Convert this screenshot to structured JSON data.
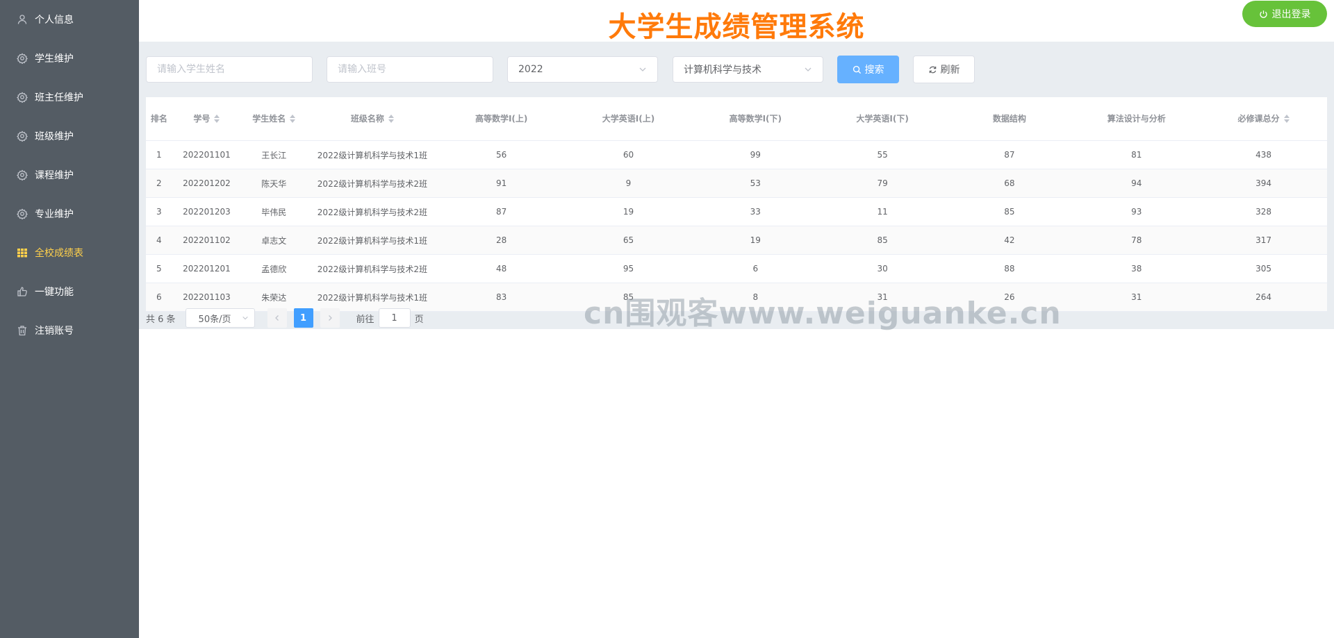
{
  "app": {
    "title": "大学生成绩管理系统",
    "logout_label": "退出登录",
    "accent_color": "#ff7a0a",
    "sidebar_bg": "#545c64",
    "active_menu_color": "#ffd04b"
  },
  "sidebar": {
    "items": [
      {
        "label": "个人信息",
        "icon": "user-icon"
      },
      {
        "label": "学生维护",
        "icon": "gear-icon"
      },
      {
        "label": "班主任维护",
        "icon": "gear-icon"
      },
      {
        "label": "班级维护",
        "icon": "gear-icon"
      },
      {
        "label": "课程维护",
        "icon": "gear-icon"
      },
      {
        "label": "专业维护",
        "icon": "gear-icon"
      },
      {
        "label": "全校成绩表",
        "icon": "grid-icon",
        "active": true
      },
      {
        "label": "一键功能",
        "icon": "thumb-icon"
      },
      {
        "label": "注销账号",
        "icon": "trash-icon"
      }
    ]
  },
  "toolbar": {
    "name_placeholder": "请输入学生姓名",
    "class_placeholder": "请输入班号",
    "year_value": "2022",
    "major_value": "计算机科学与技术",
    "search_label": "搜索",
    "refresh_label": "刷新"
  },
  "table": {
    "headers": {
      "rank": "排名",
      "student_id": "学号",
      "name": "学生姓名",
      "class_name": "班级名称",
      "math1": "高等数学I(上)",
      "eng1": "大学英语I(上)",
      "math2": "高等数学I(下)",
      "eng2": "大学英语I(下)",
      "ds": "数据结构",
      "algo": "算法设计与分析",
      "total": "必修课总分"
    },
    "rows": [
      {
        "rank": "1",
        "student_id": "202201101",
        "name": "王长江",
        "class_name": "2022级计算机科学与技术1班",
        "math1": "56",
        "eng1": "60",
        "math2": "99",
        "eng2": "55",
        "ds": "87",
        "algo": "81",
        "total": "438"
      },
      {
        "rank": "2",
        "student_id": "202201202",
        "name": "陈天华",
        "class_name": "2022级计算机科学与技术2班",
        "math1": "91",
        "eng1": "9",
        "math2": "53",
        "eng2": "79",
        "ds": "68",
        "algo": "94",
        "total": "394"
      },
      {
        "rank": "3",
        "student_id": "202201203",
        "name": "毕伟民",
        "class_name": "2022级计算机科学与技术2班",
        "math1": "87",
        "eng1": "19",
        "math2": "33",
        "eng2": "11",
        "ds": "85",
        "algo": "93",
        "total": "328"
      },
      {
        "rank": "4",
        "student_id": "202201102",
        "name": "卓志文",
        "class_name": "2022级计算机科学与技术1班",
        "math1": "28",
        "eng1": "65",
        "math2": "19",
        "eng2": "85",
        "ds": "42",
        "algo": "78",
        "total": "317"
      },
      {
        "rank": "5",
        "student_id": "202201201",
        "name": "孟德欣",
        "class_name": "2022级计算机科学与技术2班",
        "math1": "48",
        "eng1": "95",
        "math2": "6",
        "eng2": "30",
        "ds": "88",
        "algo": "38",
        "total": "305"
      },
      {
        "rank": "6",
        "student_id": "202201103",
        "name": "朱荣达",
        "class_name": "2022级计算机科学与技术1班",
        "math1": "83",
        "eng1": "85",
        "math2": "8",
        "eng2": "31",
        "ds": "26",
        "algo": "31",
        "total": "264"
      }
    ]
  },
  "pagination": {
    "total_label": "共 6 条",
    "page_size": "50条/页",
    "current_page": "1",
    "goto_label": "前往",
    "goto_value": "1",
    "page_suffix": "页"
  },
  "watermark": "cn围观客www.weiguanke.cn"
}
